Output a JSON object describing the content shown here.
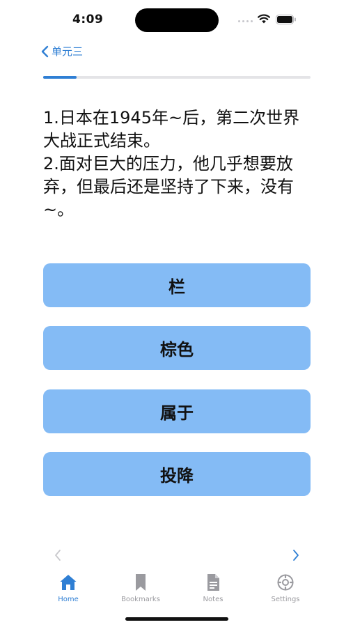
{
  "status_bar": {
    "time": "4:09"
  },
  "nav": {
    "back_label": "单元三"
  },
  "progress": {
    "fraction": 0.125
  },
  "question": {
    "line1": "1.日本在1945年~后，第二次世界大战正式结束。",
    "line2": "2.面对巨大的压力，他几乎想要放弃，但最后还是坚持了下来，没有~。"
  },
  "answers": [
    {
      "label": "栏"
    },
    {
      "label": "棕色"
    },
    {
      "label": "属于"
    },
    {
      "label": "投降"
    }
  ],
  "tabs": [
    {
      "label": "Home",
      "icon": "home-icon",
      "active": true
    },
    {
      "label": "Bookmarks",
      "icon": "bookmark-icon",
      "active": false
    },
    {
      "label": "Notes",
      "icon": "notes-icon",
      "active": false
    },
    {
      "label": "Settings",
      "icon": "settings-icon",
      "active": false
    }
  ],
  "colors": {
    "accent": "#2f7fd4",
    "answer_bg": "#84bbf5",
    "tab_inactive": "#9a9a9f"
  }
}
